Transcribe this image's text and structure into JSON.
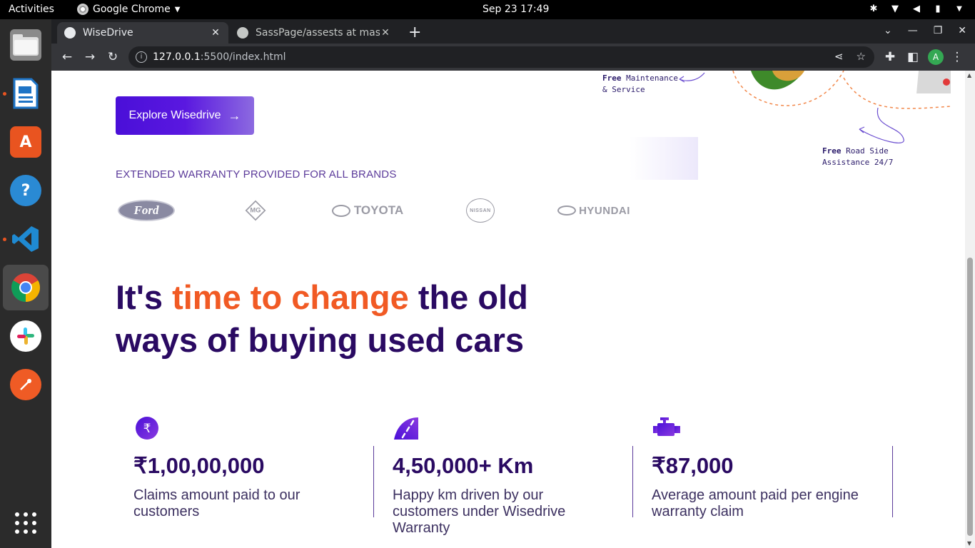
{
  "topbar": {
    "activities": "Activities",
    "app": "Google Chrome",
    "clock": "Sep 23  17:49"
  },
  "dock": {
    "items": [
      {
        "name": "files",
        "color": "#7a7a7a"
      },
      {
        "name": "writer",
        "color": "#1e74c6"
      },
      {
        "name": "software",
        "color": "#e95420"
      },
      {
        "name": "help",
        "color": "#2a8ad4"
      },
      {
        "name": "vscode",
        "color": "#1f8ad2"
      },
      {
        "name": "chrome",
        "color": "#4285f4"
      },
      {
        "name": "slack",
        "color": "#ffffff"
      },
      {
        "name": "postman",
        "color": "#ef5b25"
      },
      {
        "name": "apps-grid",
        "color": "#ffffff"
      }
    ]
  },
  "browser": {
    "tabs": [
      {
        "title": "WiseDrive",
        "active": true
      },
      {
        "title": "SassPage/assests at mast",
        "active": false
      }
    ],
    "url_host": "127.0.0.1",
    "url_path": ":5500/index.html",
    "avatar_letter": "A"
  },
  "page": {
    "explore_button": "Explore Wisedrive",
    "notes": {
      "maintenance_bold": "Free",
      "maintenance_rest": " Maintenance",
      "maintenance_line2": "& Service",
      "roadside_bold": "Free",
      "roadside_rest": " Road Side",
      "roadside_line2": "Assistance 24/7"
    },
    "warranty_heading": "EXTENDED WARRANTY PROVIDED FOR ALL BRANDS",
    "brands": {
      "ford": "Ford",
      "mg": "MG",
      "toyota": "TOYOTA",
      "nissan": "NISSAN",
      "hyundai": "HYUNDAI"
    },
    "hero": {
      "part1": "It's ",
      "accent": "time to change",
      "part2": " the old ways of buying used cars"
    },
    "stats": [
      {
        "icon": "rupee-icon",
        "value": "₹1,00,00,000",
        "desc": "Claims amount paid to our customers"
      },
      {
        "icon": "road-icon",
        "value": "4,50,000+ Km",
        "desc": "Happy km driven by our customers under Wisedrive Warranty"
      },
      {
        "icon": "engine-icon",
        "value": "₹87,000",
        "desc": "Average amount paid per engine warranty claim"
      }
    ],
    "colors": {
      "primary": "#2a0a62",
      "accent": "#f15a24",
      "button": "#4a0fd8"
    }
  }
}
